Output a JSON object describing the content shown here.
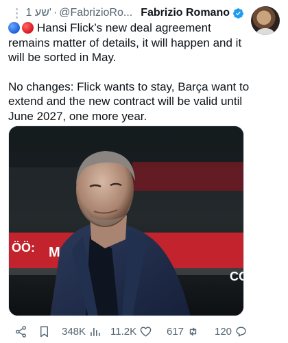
{
  "tweet": {
    "time": "1 שע'",
    "dot": "·",
    "handle": "@FabrizioRo...",
    "author": "Fabrizio Romano",
    "verified": true,
    "paragraphs": [
      "Hansi Flick’s new deal agreement remains matter of details, it will happen and it will be sorted in May.",
      "No changes: Flick wants to stay, Barça want to extend and the new contract will be valid until June 2027, one more year."
    ],
    "emoji_icons": [
      "blue-circle-icon",
      "red-circle-icon"
    ],
    "media": {
      "description_icon": "photo",
      "banner_text_left": "ÖÖ:",
      "banner_text_mid": "MA",
      "banner_text_right": "CO"
    }
  },
  "actions": {
    "share_icon": "share-icon",
    "bookmark_icon": "bookmark-icon",
    "views": "348K",
    "likes": "11.2K",
    "retweets": "617",
    "replies": "120"
  },
  "colors": {
    "text": "#0f1419",
    "muted": "#536471",
    "verified": "#1d9bf0"
  }
}
